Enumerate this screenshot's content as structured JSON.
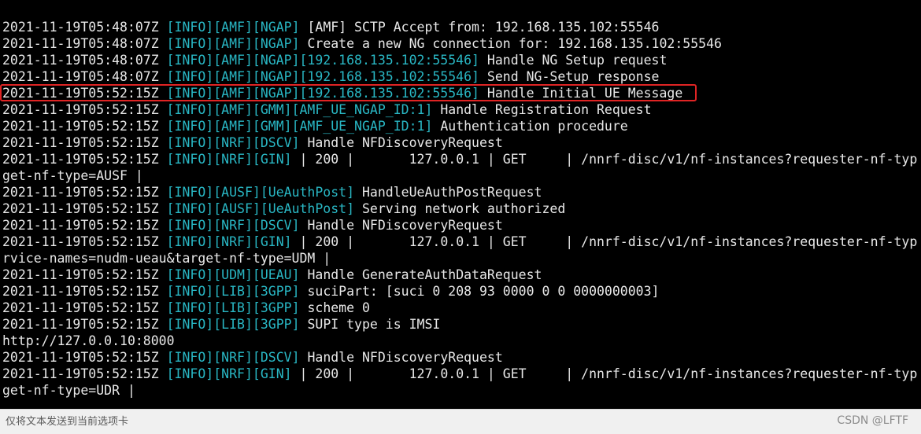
{
  "terminal": {
    "lines": [
      {
        "ts": "2021-11-19T05:48:07Z",
        "tag": "[INFO][AMF][NGAP]",
        "msg": " [AMF] SCTP Accept from: 192.168.135.102:55546"
      },
      {
        "ts": "2021-11-19T05:48:07Z",
        "tag": "[INFO][AMF][NGAP]",
        "msg": " Create a new NG connection for: 192.168.135.102:55546"
      },
      {
        "ts": "2021-11-19T05:48:07Z",
        "tag": "[INFO][AMF][NGAP][192.168.135.102:55546]",
        "msg": " Handle NG Setup request"
      },
      {
        "ts": "2021-11-19T05:48:07Z",
        "tag": "[INFO][AMF][NGAP][192.168.135.102:55546]",
        "msg": " Send NG-Setup response"
      },
      {
        "ts": "2021-11-19T05:52:15Z",
        "tag": "[INFO][AMF][NGAP][192.168.135.102:55546]",
        "msg": " Handle Initial UE Message",
        "highlighted": true
      },
      {
        "ts": "2021-11-19T05:52:15Z",
        "tag": "[INFO][AMF][GMM][AMF_UE_NGAP_ID:1]",
        "msg": " Handle Registration Request"
      },
      {
        "ts": "2021-11-19T05:52:15Z",
        "tag": "[INFO][AMF][GMM][AMF_UE_NGAP_ID:1]",
        "msg": " Authentication procedure"
      },
      {
        "ts": "2021-11-19T05:52:15Z",
        "tag": "[INFO][NRF][DSCV]",
        "msg": " Handle NFDiscoveryRequest"
      },
      {
        "ts": "2021-11-19T05:52:15Z",
        "tag": "[INFO][NRF][GIN]",
        "msg": " | 200 |       127.0.0.1 | GET     | /nnrf-disc/v1/nf-instances?requester-nf-typ"
      },
      {
        "ts": "",
        "tag": "",
        "msg": "get-nf-type=AUSF |"
      },
      {
        "ts": "2021-11-19T05:52:15Z",
        "tag": "[INFO][AUSF][UeAuthPost]",
        "msg": " HandleUeAuthPostRequest"
      },
      {
        "ts": "2021-11-19T05:52:15Z",
        "tag": "[INFO][AUSF][UeAuthPost]",
        "msg": " Serving network authorized"
      },
      {
        "ts": "2021-11-19T05:52:15Z",
        "tag": "[INFO][NRF][DSCV]",
        "msg": " Handle NFDiscoveryRequest"
      },
      {
        "ts": "2021-11-19T05:52:15Z",
        "tag": "[INFO][NRF][GIN]",
        "msg": " | 200 |       127.0.0.1 | GET     | /nnrf-disc/v1/nf-instances?requester-nf-typ"
      },
      {
        "ts": "",
        "tag": "",
        "msg": "rvice-names=nudm-ueau&target-nf-type=UDM |"
      },
      {
        "ts": "2021-11-19T05:52:15Z",
        "tag": "[INFO][UDM][UEAU]",
        "msg": " Handle GenerateAuthDataRequest"
      },
      {
        "ts": "2021-11-19T05:52:15Z",
        "tag": "[INFO][LIB][3GPP]",
        "msg": " suciPart: [suci 0 208 93 0000 0 0 0000000003]"
      },
      {
        "ts": "2021-11-19T05:52:15Z",
        "tag": "[INFO][LIB][3GPP]",
        "msg": " scheme 0"
      },
      {
        "ts": "2021-11-19T05:52:15Z",
        "tag": "[INFO][LIB][3GPP]",
        "msg": " SUPI type is IMSI"
      },
      {
        "ts": "",
        "tag": "",
        "msg": "http://127.0.0.10:8000"
      },
      {
        "ts": "2021-11-19T05:52:15Z",
        "tag": "[INFO][NRF][DSCV]",
        "msg": " Handle NFDiscoveryRequest"
      },
      {
        "ts": "2021-11-19T05:52:15Z",
        "tag": "[INFO][NRF][GIN]",
        "msg": " | 200 |       127.0.0.1 | GET     | /nnrf-disc/v1/nf-instances?requester-nf-typ"
      },
      {
        "ts": "",
        "tag": "",
        "msg": "get-nf-type=UDR |"
      }
    ]
  },
  "input_bar": {
    "placeholder": "仅将文本发送到当前选项卡"
  },
  "watermark": "CSDN @LFTF",
  "colors": {
    "terminal_bg": "#000000",
    "text": "#e8e8e8",
    "tag": "#29b7c4",
    "highlight_border": "#e02424"
  }
}
